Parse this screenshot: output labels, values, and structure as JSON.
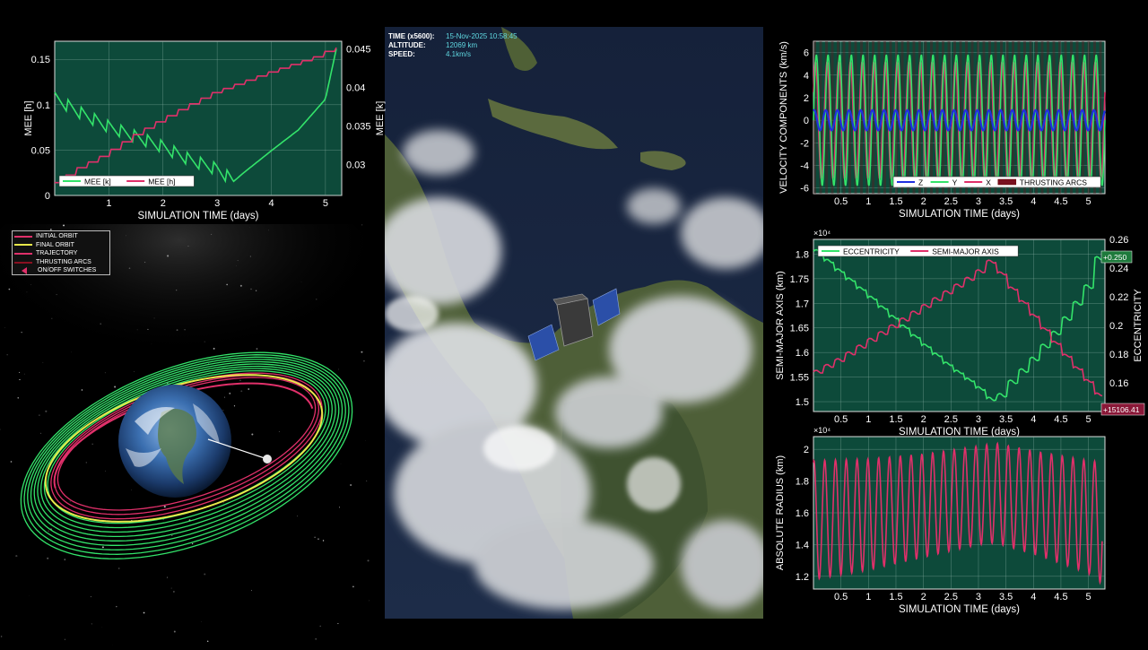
{
  "hud": {
    "time_label": "TIME (x5600):",
    "time_value": "15-Nov-2025 10:58:45",
    "alt_label": "ALTITUDE:",
    "alt_value": "12069 km",
    "speed_label": "SPEED:",
    "speed_value": "4.1km/s"
  },
  "colors": {
    "panel_bg": "#0d4a3a",
    "green": "#33e36a",
    "red": "#e0306a",
    "blue": "#2030e0",
    "yellow": "#e8e84a"
  },
  "legend3d": [
    {
      "label": "INITIAL ORBIT",
      "color": "#e0306a"
    },
    {
      "label": "FINAL ORBIT",
      "color": "#e8e84a"
    },
    {
      "label": "TRAJECTORY",
      "color": "#e0306a"
    },
    {
      "label": "THRUSTING ARCS",
      "color": "#8a1020"
    },
    {
      "label": "ON/OFF SWITCHES",
      "color": "#e0306a"
    }
  ],
  "chart_data": [
    {
      "type": "line",
      "id": "mee",
      "xlabel": "SIMULATION TIME (days)",
      "ylabel": "MEE [h]",
      "y2label": "MEE [k]",
      "xticks": [
        "1",
        "2",
        "3",
        "4",
        "5"
      ],
      "yticks": [
        "0",
        "0.05",
        "0.1",
        "0.15"
      ],
      "y2ticks": [
        "0.03",
        "0.035",
        "0.04",
        "0.045"
      ],
      "xlim": [
        0,
        5.3
      ],
      "ylim": [
        0,
        0.17
      ],
      "y2lim": [
        0.026,
        0.046
      ],
      "grid": true,
      "legend_position": "bottom-left",
      "series": [
        {
          "name": "MEE [k]",
          "axis": "right",
          "x": [
            0,
            0.5,
            1,
            1.5,
            2,
            2.5,
            3,
            3.3,
            3.5,
            4,
            4.5,
            5,
            5.2
          ],
          "y": [
            0.0385,
            0.0365,
            0.0348,
            0.0335,
            0.0322,
            0.0305,
            0.0293,
            0.0278,
            0.029,
            0.0318,
            0.0345,
            0.0385,
            0.045
          ]
        },
        {
          "name": "MEE [h]",
          "axis": "left",
          "x": [
            0,
            0.5,
            1,
            1.5,
            2,
            2.5,
            3,
            3.5,
            4,
            4.5,
            5,
            5.2
          ],
          "y": [
            0.01,
            0.03,
            0.045,
            0.065,
            0.082,
            0.098,
            0.113,
            0.124,
            0.135,
            0.145,
            0.155,
            0.163
          ]
        }
      ]
    },
    {
      "type": "line",
      "id": "velocity",
      "xlabel": "SIMULATION TIME (days)",
      "ylabel": "VELOCITY COMPONENTS (km/s)",
      "xticks": [
        "0.5",
        "1",
        "1.5",
        "2",
        "2.5",
        "3",
        "3.5",
        "4",
        "4.5",
        "5"
      ],
      "yticks": [
        "-6",
        "-4",
        "-2",
        "0",
        "2",
        "4",
        "6"
      ],
      "xlim": [
        0,
        5.3
      ],
      "ylim": [
        -6.5,
        7
      ],
      "grid": true,
      "legend_position": "bottom-right",
      "oscillations": 25,
      "series": [
        {
          "name": "Z",
          "amplitude": 0.9
        },
        {
          "name": "Y",
          "amplitude": 5.8
        },
        {
          "name": "X",
          "amplitude": 5.2
        },
        {
          "name": "THRUSTING ARCS"
        }
      ]
    },
    {
      "type": "line",
      "id": "sma",
      "xlabel": "SIMULATION TIME (days)",
      "ylabel": "SEMI-MAJOR AXIS (km)",
      "y2label": "ECCENTRICITY",
      "y_exponent": "×10⁴",
      "xticks": [
        "0.5",
        "1",
        "1.5",
        "2",
        "2.5",
        "3",
        "3.5",
        "4",
        "4.5",
        "5"
      ],
      "yticks": [
        "1.5",
        "1.55",
        "1.6",
        "1.65",
        "1.7",
        "1.75",
        "1.8"
      ],
      "y2ticks": [
        "0.14",
        "0.16",
        "0.18",
        "0.2",
        "0.22",
        "0.24",
        "0.26"
      ],
      "xlim": [
        0,
        5.3
      ],
      "ylim": [
        1.48,
        1.83
      ],
      "y2lim": [
        0.14,
        0.26
      ],
      "grid": true,
      "legend_position": "top-left",
      "value_tags": [
        "+0.250",
        "+15106.41"
      ],
      "series": [
        {
          "name": "ECCENTRICITY",
          "axis": "right",
          "x": [
            0,
            0.5,
            1,
            1.5,
            2,
            2.5,
            3,
            3.35,
            3.5,
            4,
            4.5,
            5,
            5.25
          ],
          "y": [
            0.255,
            0.238,
            0.222,
            0.205,
            0.188,
            0.172,
            0.158,
            0.145,
            0.155,
            0.175,
            0.198,
            0.225,
            0.25
          ]
        },
        {
          "name": "SEMI-MAJOR AXIS",
          "axis": "left",
          "x": [
            0,
            0.5,
            1,
            1.5,
            2,
            2.5,
            3,
            3.3,
            3.5,
            4,
            4.5,
            5,
            5.25
          ],
          "y": [
            1.555,
            1.585,
            1.62,
            1.655,
            1.69,
            1.725,
            1.76,
            1.79,
            1.75,
            1.68,
            1.61,
            1.545,
            1.51
          ]
        }
      ]
    },
    {
      "type": "line",
      "id": "radius",
      "xlabel": "SIMULATION TIME (days)",
      "ylabel": "ABSOLUTE RADIUS (km)",
      "y_exponent": "×10⁴",
      "xticks": [
        "0.5",
        "1",
        "1.5",
        "2",
        "2.5",
        "3",
        "3.5",
        "4",
        "4.5",
        "5"
      ],
      "yticks": [
        "1.2",
        "1.4",
        "1.6",
        "1.8",
        "2"
      ],
      "xlim": [
        0,
        5.3
      ],
      "ylim": [
        1.12,
        2.08
      ],
      "grid": true,
      "oscillations": 27,
      "series": [
        {
          "name": "ABSOLUTE RADIUS",
          "x": [
            0,
            1,
            2,
            3,
            3.3,
            4,
            5,
            5.25
          ],
          "max": [
            1.93,
            1.94,
            1.97,
            2.02,
            2.04,
            1.99,
            1.93,
            1.92
          ],
          "min": [
            1.18,
            1.24,
            1.32,
            1.4,
            1.41,
            1.34,
            1.22,
            1.15
          ]
        }
      ]
    }
  ]
}
